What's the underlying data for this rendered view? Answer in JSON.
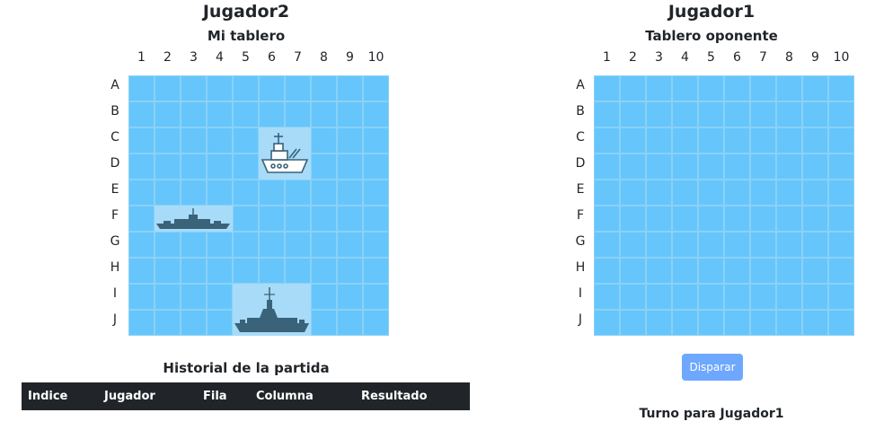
{
  "left_panel": {
    "player_name": "Jugador2",
    "board_title": "Mi tablero",
    "columns": [
      "1",
      "2",
      "3",
      "4",
      "5",
      "6",
      "7",
      "8",
      "9",
      "10"
    ],
    "rows": [
      "A",
      "B",
      "C",
      "D",
      "E",
      "F",
      "G",
      "H",
      "I",
      "J"
    ],
    "ships": [
      {
        "name": "battleship",
        "icon": "battleship-icon",
        "cells": [
          "C6",
          "C7",
          "D6",
          "D7"
        ]
      },
      {
        "name": "patrol-boat",
        "icon": "patrol-boat-icon",
        "cells": [
          "F2",
          "F3",
          "F4"
        ]
      },
      {
        "name": "destroyer",
        "icon": "destroyer-icon",
        "cells": [
          "I5",
          "I6",
          "I7",
          "J5",
          "J6",
          "J7"
        ]
      }
    ]
  },
  "right_panel": {
    "player_name": "Jugador1",
    "board_title": "Tablero oponente",
    "columns": [
      "1",
      "2",
      "3",
      "4",
      "5",
      "6",
      "7",
      "8",
      "9",
      "10"
    ],
    "rows": [
      "A",
      "B",
      "C",
      "D",
      "E",
      "F",
      "G",
      "H",
      "I",
      "J"
    ]
  },
  "history": {
    "title": "Historial de la partida",
    "headers": [
      "Indice",
      "Jugador",
      "Fila",
      "Columna",
      "Resultado"
    ]
  },
  "actions": {
    "fire_label": "Disparar"
  },
  "status": {
    "turn_text": "Turno para Jugador1"
  },
  "colors": {
    "water": "#66c6fb",
    "ship_cell": "#a7dbf8",
    "ship_icon": "#3a6279",
    "table_header": "#212529",
    "button": "#6ea8fe"
  }
}
